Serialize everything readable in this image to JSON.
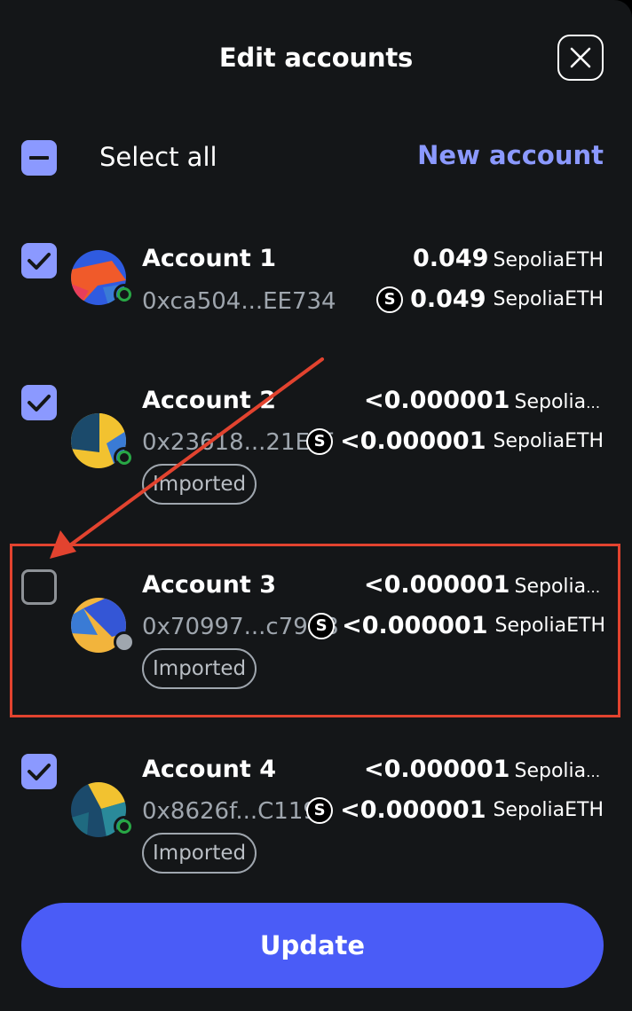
{
  "header": {
    "title": "Edit accounts"
  },
  "toolbar": {
    "select_all_label": "Select all",
    "new_account_label": "New account"
  },
  "accounts": [
    {
      "name": "Account 1",
      "address": "0xca504...EE734",
      "balance_primary": "0.049",
      "balance_primary_unit": "SepoliaETH",
      "balance_secondary": "0.049",
      "balance_secondary_unit": "SepoliaETH",
      "checked": true,
      "badge": ""
    },
    {
      "name": "Account 2",
      "address": "0x23618...21E8f",
      "balance_primary": "<0.000001",
      "balance_primary_unit": "Sepolia...",
      "balance_secondary": "<0.000001",
      "balance_secondary_unit": "SepoliaETH",
      "checked": true,
      "badge": "Imported"
    },
    {
      "name": "Account 3",
      "address": "0x70997...c79C8",
      "balance_primary": "<0.000001",
      "balance_primary_unit": "Sepolia...",
      "balance_secondary": "<0.000001",
      "balance_secondary_unit": "SepoliaETH",
      "checked": false,
      "badge": "Imported"
    },
    {
      "name": "Account 4",
      "address": "0x8626f...C1199",
      "balance_primary": "<0.000001",
      "balance_primary_unit": "Sepolia...",
      "balance_secondary": "<0.000001",
      "balance_secondary_unit": "SepoliaETH",
      "checked": true,
      "badge": "Imported"
    }
  ],
  "token_icon_letter": "S",
  "footer": {
    "update_label": "Update"
  },
  "colors": {
    "accent": "#8b99ff",
    "primary_button": "#4a5cf7",
    "background": "#141618",
    "highlight": "#e2432f",
    "connected_dot": "#28a745"
  }
}
